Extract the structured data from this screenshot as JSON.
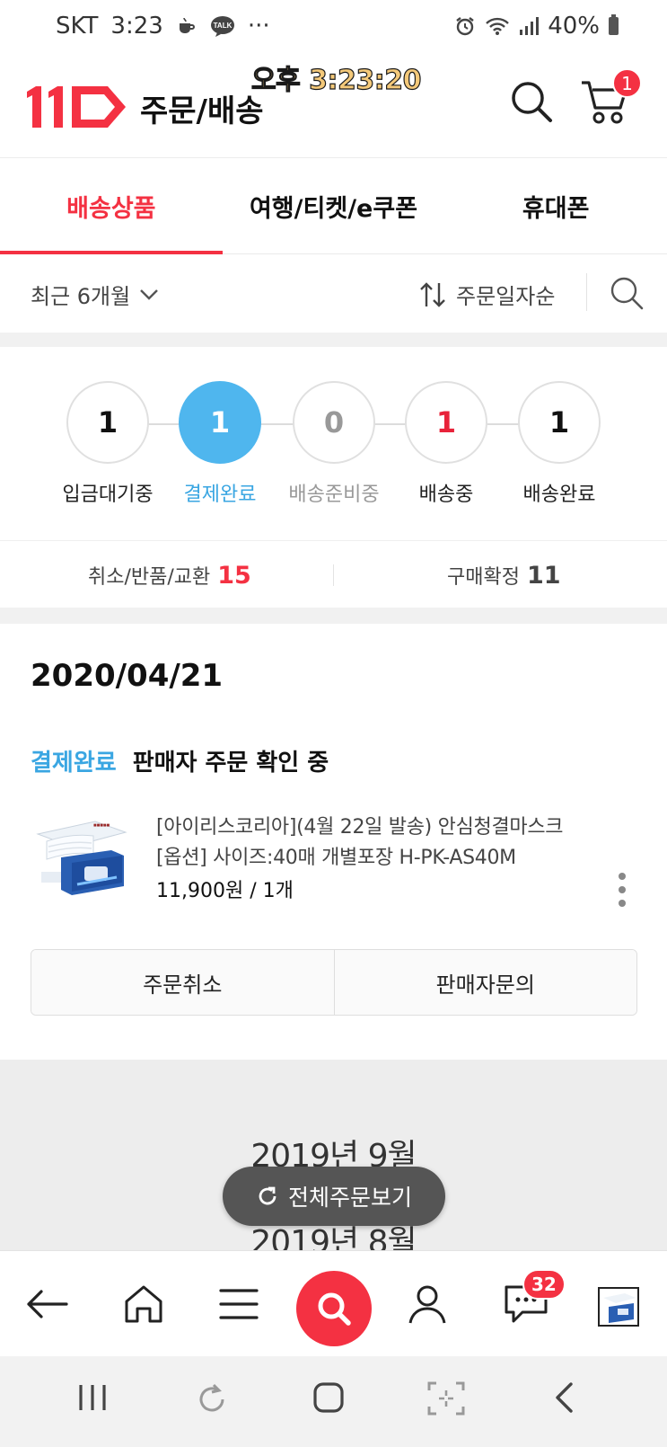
{
  "status_bar": {
    "carrier": "SKT",
    "time": "3:23",
    "dots": "···",
    "battery": "40%",
    "icons": [
      "coffee-icon",
      "talk-icon",
      "alarm-icon",
      "wifi-icon",
      "signal-icon",
      "battery-icon"
    ]
  },
  "header": {
    "logo_text": "11st",
    "title": "주문/배송",
    "overlay_time": "오후 3:23:20",
    "cart_count": "1"
  },
  "tabs": [
    {
      "label": "배송상품",
      "active": true
    },
    {
      "label": "여행/티켓/e쿠폰",
      "active": false
    },
    {
      "label": "휴대폰",
      "active": false
    }
  ],
  "filter": {
    "period": "최근 6개월",
    "sort": "주문일자순"
  },
  "steps": [
    {
      "count": "1",
      "label": "입금대기중",
      "state": "normal"
    },
    {
      "count": "1",
      "label": "결제완료",
      "state": "active"
    },
    {
      "count": "0",
      "label": "배송준비중",
      "state": "dim"
    },
    {
      "count": "1",
      "label": "배송중",
      "state": "red"
    },
    {
      "count": "1",
      "label": "배송완료",
      "state": "normal"
    }
  ],
  "counts": {
    "cancel_label": "취소/반품/교환",
    "cancel_value": "15",
    "confirm_label": "구매확정",
    "confirm_value": "11"
  },
  "order": {
    "date": "2020/04/21",
    "status": "결제완료",
    "status_detail": "판매자 주문 확인 중",
    "product_name": "[아이리스코리아](4월 22일 발송) 안심청결마스크",
    "product_option": "[옵션] 사이즈:40매 개별포장 H-PK-AS40M",
    "price": "11,900원 / 1개",
    "buttons": {
      "cancel": "주문취소",
      "inquiry": "판매자문의"
    }
  },
  "months": [
    "2019년 9월",
    "2019년 8월"
  ],
  "fab_label": "전체주문보기",
  "bottom_nav": {
    "message_count": "32"
  },
  "colors": {
    "brand_red": "#f43142",
    "accent_blue": "#4fb6ee"
  }
}
